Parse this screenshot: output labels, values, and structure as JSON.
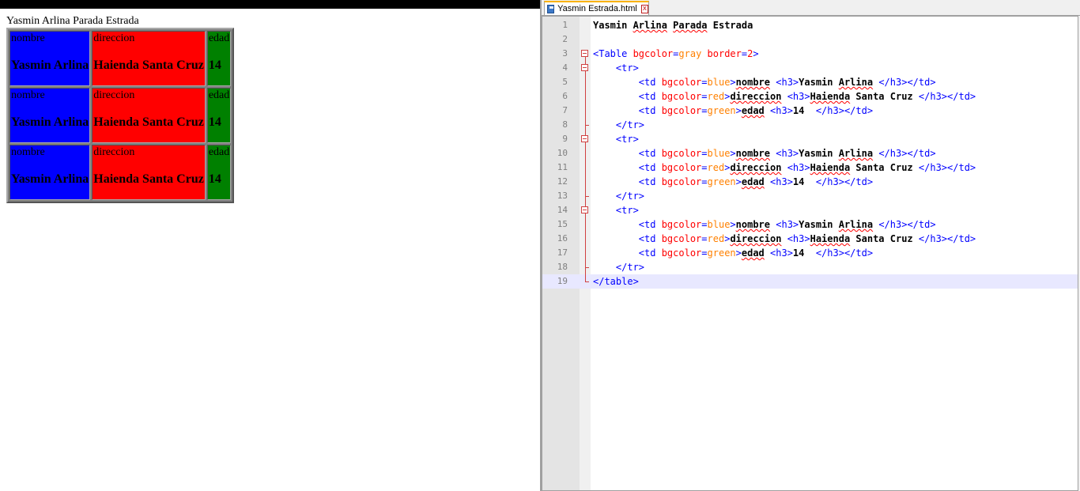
{
  "browser": {
    "page_heading": "Yasmin Arlina Parada Estrada",
    "table": {
      "rows": [
        {
          "cells": [
            {
              "label": "nombre",
              "value": "Yasmin Arlina",
              "color": "#0000ff"
            },
            {
              "label": "direccion",
              "value": "Haienda Santa Cruz",
              "color": "#ff0000"
            },
            {
              "label": "edad",
              "value": "14",
              "color": "#008000"
            }
          ]
        },
        {
          "cells": [
            {
              "label": "nombre",
              "value": "Yasmin Arlina",
              "color": "#0000ff"
            },
            {
              "label": "direccion",
              "value": "Haienda Santa Cruz",
              "color": "#ff0000"
            },
            {
              "label": "edad",
              "value": "14",
              "color": "#008000"
            }
          ]
        },
        {
          "cells": [
            {
              "label": "nombre",
              "value": "Yasmin Arlina",
              "color": "#0000ff"
            },
            {
              "label": "direccion",
              "value": "Haienda Santa Cruz",
              "color": "#ff0000"
            },
            {
              "label": "edad",
              "value": "14",
              "color": "#008000"
            }
          ]
        }
      ]
    }
  },
  "editor": {
    "tab": {
      "label": "Yasmin Estrada.html",
      "icon": "save-icon",
      "close_icon": "close-icon",
      "close_glyph": "x"
    },
    "current_line": 19,
    "lines": [
      {
        "num": "1",
        "tokens": [
          {
            "t": "txt",
            "v": "Yasmin Arlina Parada Estrada"
          }
        ]
      },
      {
        "num": "2",
        "tokens": []
      },
      {
        "num": "3",
        "tokens": [
          {
            "t": "tag",
            "v": "<Table "
          },
          {
            "t": "attr",
            "v": "bgcolor"
          },
          {
            "t": "tag",
            "v": "="
          },
          {
            "t": "val",
            "v": "gray"
          },
          {
            "t": "tag",
            "v": " "
          },
          {
            "t": "attr",
            "v": "border"
          },
          {
            "t": "tag",
            "v": "="
          },
          {
            "t": "attr",
            "v": "2"
          },
          {
            "t": "tag",
            "v": ">"
          }
        ]
      },
      {
        "num": "4",
        "tokens": [
          {
            "t": "plain",
            "v": "    "
          },
          {
            "t": "tag",
            "v": "<tr>"
          }
        ]
      },
      {
        "num": "5",
        "tokens": [
          {
            "t": "plain",
            "v": "        "
          },
          {
            "t": "tag",
            "v": "<td "
          },
          {
            "t": "attr",
            "v": "bgcolor"
          },
          {
            "t": "tag",
            "v": "="
          },
          {
            "t": "val",
            "v": "blue"
          },
          {
            "t": "tag",
            "v": ">"
          },
          {
            "t": "txt",
            "v": "nombre "
          },
          {
            "t": "tag",
            "v": "<h3>"
          },
          {
            "t": "txt",
            "v": "Yasmin Arlina "
          },
          {
            "t": "tag",
            "v": "</h3></td>"
          }
        ]
      },
      {
        "num": "6",
        "tokens": [
          {
            "t": "plain",
            "v": "        "
          },
          {
            "t": "tag",
            "v": "<td "
          },
          {
            "t": "attr",
            "v": "bgcolor"
          },
          {
            "t": "tag",
            "v": "="
          },
          {
            "t": "val",
            "v": "red"
          },
          {
            "t": "tag",
            "v": ">"
          },
          {
            "t": "txt",
            "v": "direccion "
          },
          {
            "t": "tag",
            "v": "<h3>"
          },
          {
            "t": "txt",
            "v": "Haienda Santa Cruz "
          },
          {
            "t": "tag",
            "v": "</h3></td>"
          }
        ]
      },
      {
        "num": "7",
        "tokens": [
          {
            "t": "plain",
            "v": "        "
          },
          {
            "t": "tag",
            "v": "<td "
          },
          {
            "t": "attr",
            "v": "bgcolor"
          },
          {
            "t": "tag",
            "v": "="
          },
          {
            "t": "val",
            "v": "green"
          },
          {
            "t": "tag",
            "v": ">"
          },
          {
            "t": "txt",
            "v": "edad "
          },
          {
            "t": "tag",
            "v": "<h3>"
          },
          {
            "t": "txt",
            "v": "14  "
          },
          {
            "t": "tag",
            "v": "</h3></td>"
          }
        ]
      },
      {
        "num": "8",
        "tokens": [
          {
            "t": "plain",
            "v": "    "
          },
          {
            "t": "tag",
            "v": "</tr>"
          }
        ]
      },
      {
        "num": "9",
        "tokens": [
          {
            "t": "plain",
            "v": "    "
          },
          {
            "t": "tag",
            "v": "<tr>"
          }
        ]
      },
      {
        "num": "10",
        "tokens": [
          {
            "t": "plain",
            "v": "        "
          },
          {
            "t": "tag",
            "v": "<td "
          },
          {
            "t": "attr",
            "v": "bgcolor"
          },
          {
            "t": "tag",
            "v": "="
          },
          {
            "t": "val",
            "v": "blue"
          },
          {
            "t": "tag",
            "v": ">"
          },
          {
            "t": "txt",
            "v": "nombre "
          },
          {
            "t": "tag",
            "v": "<h3>"
          },
          {
            "t": "txt",
            "v": "Yasmin Arlina "
          },
          {
            "t": "tag",
            "v": "</h3></td>"
          }
        ]
      },
      {
        "num": "11",
        "tokens": [
          {
            "t": "plain",
            "v": "        "
          },
          {
            "t": "tag",
            "v": "<td "
          },
          {
            "t": "attr",
            "v": "bgcolor"
          },
          {
            "t": "tag",
            "v": "="
          },
          {
            "t": "val",
            "v": "red"
          },
          {
            "t": "tag",
            "v": ">"
          },
          {
            "t": "txt",
            "v": "direccion "
          },
          {
            "t": "tag",
            "v": "<h3>"
          },
          {
            "t": "txt",
            "v": "Haienda Santa Cruz "
          },
          {
            "t": "tag",
            "v": "</h3></td>"
          }
        ]
      },
      {
        "num": "12",
        "tokens": [
          {
            "t": "plain",
            "v": "        "
          },
          {
            "t": "tag",
            "v": "<td "
          },
          {
            "t": "attr",
            "v": "bgcolor"
          },
          {
            "t": "tag",
            "v": "="
          },
          {
            "t": "val",
            "v": "green"
          },
          {
            "t": "tag",
            "v": ">"
          },
          {
            "t": "txt",
            "v": "edad "
          },
          {
            "t": "tag",
            "v": "<h3>"
          },
          {
            "t": "txt",
            "v": "14  "
          },
          {
            "t": "tag",
            "v": "</h3></td>"
          }
        ]
      },
      {
        "num": "13",
        "tokens": [
          {
            "t": "plain",
            "v": "    "
          },
          {
            "t": "tag",
            "v": "</tr>"
          }
        ]
      },
      {
        "num": "14",
        "tokens": [
          {
            "t": "plain",
            "v": "    "
          },
          {
            "t": "tag",
            "v": "<tr>"
          }
        ]
      },
      {
        "num": "15",
        "tokens": [
          {
            "t": "plain",
            "v": "        "
          },
          {
            "t": "tag",
            "v": "<td "
          },
          {
            "t": "attr",
            "v": "bgcolor"
          },
          {
            "t": "tag",
            "v": "="
          },
          {
            "t": "val",
            "v": "blue"
          },
          {
            "t": "tag",
            "v": ">"
          },
          {
            "t": "txt",
            "v": "nombre "
          },
          {
            "t": "tag",
            "v": "<h3>"
          },
          {
            "t": "txt",
            "v": "Yasmin Arlina "
          },
          {
            "t": "tag",
            "v": "</h3></td>"
          }
        ]
      },
      {
        "num": "16",
        "tokens": [
          {
            "t": "plain",
            "v": "        "
          },
          {
            "t": "tag",
            "v": "<td "
          },
          {
            "t": "attr",
            "v": "bgcolor"
          },
          {
            "t": "tag",
            "v": "="
          },
          {
            "t": "val",
            "v": "red"
          },
          {
            "t": "tag",
            "v": ">"
          },
          {
            "t": "txt",
            "v": "direccion "
          },
          {
            "t": "tag",
            "v": "<h3>"
          },
          {
            "t": "txt",
            "v": "Haienda Santa Cruz "
          },
          {
            "t": "tag",
            "v": "</h3></td>"
          }
        ]
      },
      {
        "num": "17",
        "tokens": [
          {
            "t": "plain",
            "v": "        "
          },
          {
            "t": "tag",
            "v": "<td "
          },
          {
            "t": "attr",
            "v": "bgcolor"
          },
          {
            "t": "tag",
            "v": "="
          },
          {
            "t": "val",
            "v": "green"
          },
          {
            "t": "tag",
            "v": ">"
          },
          {
            "t": "txt",
            "v": "edad "
          },
          {
            "t": "tag",
            "v": "<h3>"
          },
          {
            "t": "txt",
            "v": "14  "
          },
          {
            "t": "tag",
            "v": "</h3></td>"
          }
        ]
      },
      {
        "num": "18",
        "tokens": [
          {
            "t": "plain",
            "v": "    "
          },
          {
            "t": "tag",
            "v": "</tr>"
          }
        ]
      },
      {
        "num": "19",
        "tokens": [
          {
            "t": "tag",
            "v": "</table>"
          }
        ]
      }
    ]
  },
  "colors": {
    "table_bg": "#808080",
    "tag": "#0000ff",
    "attr": "#ff0000",
    "value": "#ff8000",
    "current_line_bg": "#e8e8ff",
    "tab_accent": "#fab200"
  }
}
